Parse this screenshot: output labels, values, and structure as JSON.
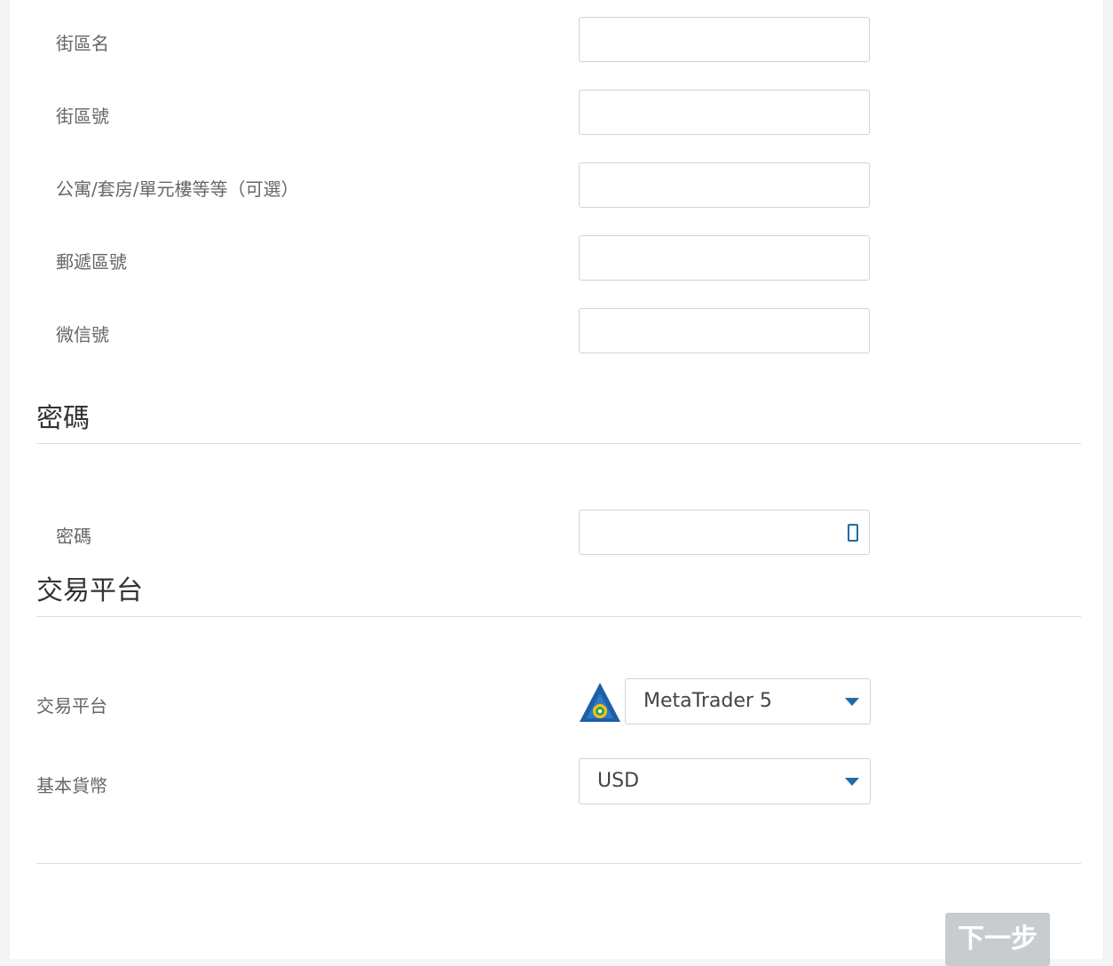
{
  "address_fields": [
    {
      "label": "街區名",
      "value": ""
    },
    {
      "label": "街區號",
      "value": ""
    },
    {
      "label": "公寓/套房/單元樓等等（可選）",
      "value": ""
    },
    {
      "label": "郵遞區號",
      "value": ""
    },
    {
      "label": "微信號",
      "value": ""
    }
  ],
  "password_section": {
    "title": "密碼",
    "field_label": "密碼",
    "value": "",
    "toggle_icon": "eye-icon"
  },
  "platform_section": {
    "title": "交易平台",
    "platform_label": "交易平台",
    "platform_value": "MetaTrader 5",
    "currency_label": "基本貨幣",
    "currency_value": "USD"
  },
  "footer": {
    "next_label": "下一步"
  },
  "colors": {
    "accent": "#1c6ea4",
    "disabled_button": "#c9cccf",
    "divider": "#d9dde0"
  }
}
